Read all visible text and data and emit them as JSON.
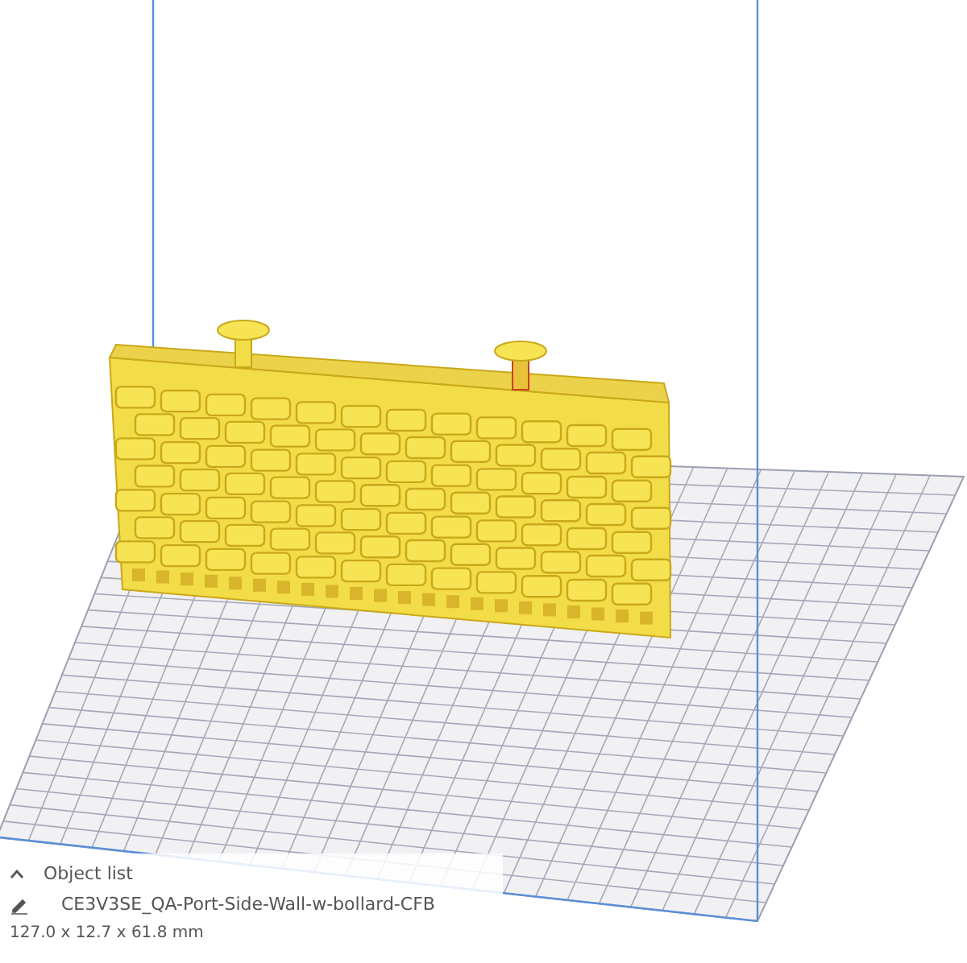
{
  "object_list": {
    "label": "Object list",
    "expanded": false,
    "object_name": "CE3V3SE_QA-Port-Side-Wall-w-bollard-CFB",
    "dimensions": "127.0 x 12.7 x 61.8 mm"
  }
}
